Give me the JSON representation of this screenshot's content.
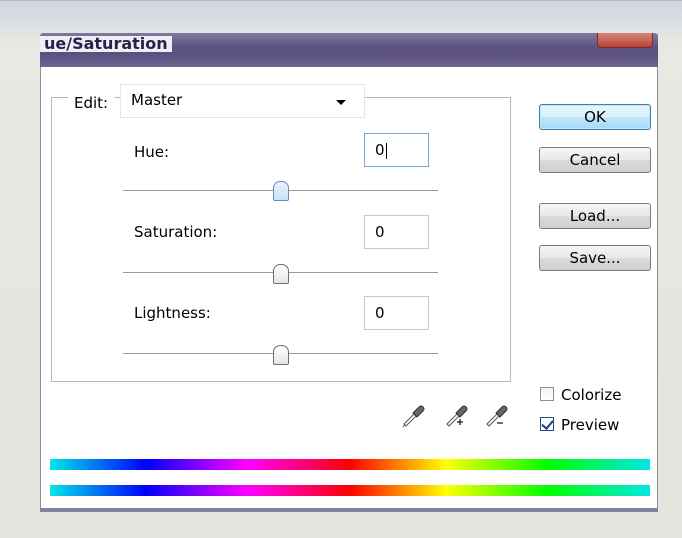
{
  "window": {
    "title": "ue/Saturation"
  },
  "edit": {
    "label": "Edit:",
    "selected": "Master"
  },
  "fields": {
    "hue": {
      "label": "Hue:",
      "value": "0"
    },
    "saturation": {
      "label": "Saturation:",
      "value": "0"
    },
    "lightness": {
      "label": "Lightness:",
      "value": "0"
    }
  },
  "sliders": {
    "hue_fraction": 0.5,
    "saturation_fraction": 0.5,
    "lightness_fraction": 0.5
  },
  "buttons": {
    "ok": "OK",
    "cancel": "Cancel",
    "load": "Load...",
    "save": "Save..."
  },
  "options": {
    "colorize": {
      "label": "Colorize",
      "checked": false
    },
    "preview": {
      "label": "Preview",
      "checked": true
    }
  },
  "icons": {
    "eyedropper": "eyedropper-icon",
    "eyedropper_plus": "eyedropper-plus-icon",
    "eyedropper_minus": "eyedropper-minus-icon",
    "dropdown": "chevron-down-icon"
  },
  "colors": {
    "title_bar": "#5e5383",
    "default_button": "#bee6fd",
    "spectrum": [
      "#00e6e6",
      "#0000ff",
      "#ff00ff",
      "#ff0000",
      "#ffff00",
      "#00ff00",
      "#00e6e6"
    ]
  }
}
